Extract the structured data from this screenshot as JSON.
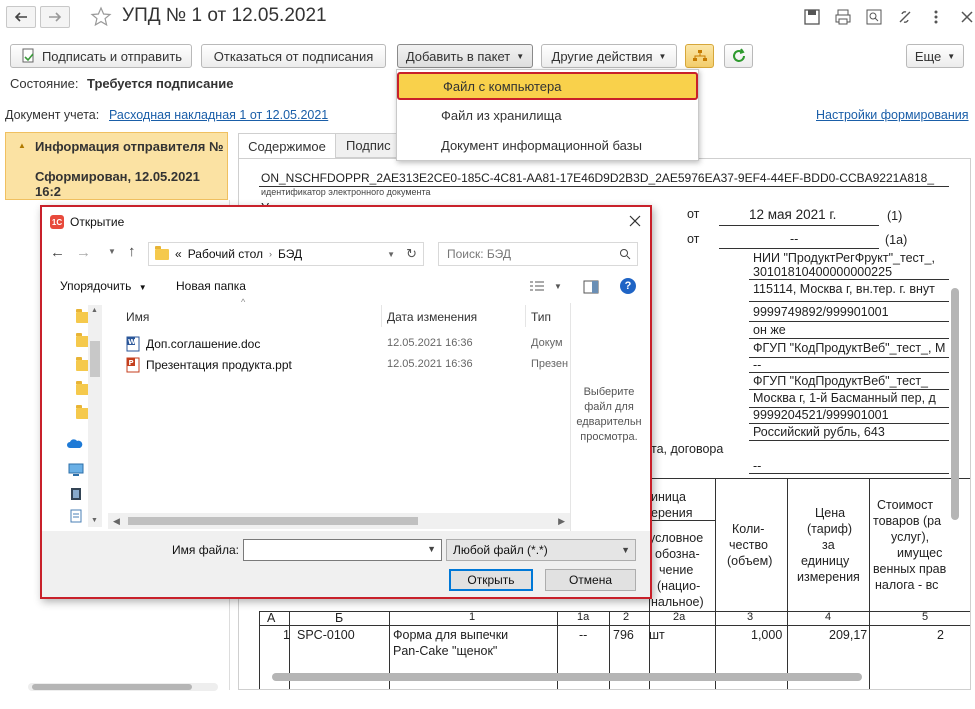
{
  "window": {
    "title": "УПД № 1 от 12.05.2021"
  },
  "toolbar": {
    "sign_send": "Подписать и отправить",
    "refuse_sign": "Отказаться от подписания",
    "add_to_package": "Добавить в пакет",
    "other_actions": "Другие действия",
    "more": "Еще"
  },
  "status": {
    "label": "Состояние:",
    "value": "Требуется подписание"
  },
  "account_doc": {
    "label": "Документ учета:",
    "link": "Расходная накладная 1 от 12.05.2021",
    "settings_link": "Настройки формирования"
  },
  "dropdown": {
    "items": [
      "Файл с компьютера",
      "Файл из хранилища",
      "Документ информационной базы"
    ]
  },
  "left_panel": {
    "title": "Информация отправителя №",
    "subtitle": "Сформирован, 12.05.2021 16:2"
  },
  "tabs": [
    "Содержимое",
    "Подпис"
  ],
  "document": {
    "id_line": "ON_NSCHFDOPPR_2AE313E2CE0-185C-4C81-AA81-17E46D9D2B3D_2AE5976EA37-9EF4-44EF-BDD0-CCBA9221A818_",
    "id_caption": "идентификатор электронного документа",
    "from1": "от",
    "date1": "12 мая 2021 г.",
    "mark1": "(1)",
    "from2": "от",
    "date2": "--",
    "mark2": "(1а)",
    "fields": [
      "НИИ \"ПродуктРегФрукт\"_тест_,",
      "30101810400000000225",
      "115114, Москва г, вн.тер. г. внут",
      "9999749892/999901001",
      "он же",
      "ФГУП \"КодПродуктВеб\"_тест_, М",
      "--",
      "ФГУП \"КодПродуктВеб\"_тест_",
      "Москва г, 1-й Басманный пер, д",
      "9999204521/999901001",
      "Российский рубль, 643"
    ],
    "contract_text": "та, договора",
    "dash": "--",
    "headers": {
      "unit": [
        "иница",
        "ерения"
      ],
      "unit_sub": [
        "условное",
        "обозна-",
        "чение",
        "(нацио-",
        "нальное)"
      ],
      "qty": [
        "Коли-",
        "чество",
        "(объем)"
      ],
      "price": [
        "Цена",
        "(тариф)",
        "за",
        "единицу",
        "измерения"
      ],
      "cost": [
        "Стоимост",
        "товаров (ра",
        "услуг),",
        "имущес",
        "венных прав",
        "налога - вс"
      ]
    },
    "col_nums": [
      "А",
      "Б",
      "1",
      "1а",
      "2",
      "2а",
      "3",
      "4",
      "5"
    ],
    "row": {
      "n": "1",
      "code": "SPC-0100",
      "name1": "Форма для выпечки",
      "name2": "Pan-Cake \"щенок\"",
      "dash": "--",
      "unit_code": "796",
      "unit": "шт",
      "qty": "1,000",
      "price": "209,17",
      "cost": "2"
    }
  },
  "dialog": {
    "title": "Открытие",
    "path_prefix": "«",
    "path": [
      "Рабочий стол",
      "БЭД"
    ],
    "search_placeholder": "Поиск: БЭД",
    "organize": "Упорядочить",
    "new_folder": "Новая папка",
    "columns": {
      "name": "Имя",
      "date": "Дата изменения",
      "type": "Тип"
    },
    "files": [
      {
        "name": "Доп.соглашение.doc",
        "date": "12.05.2021 16:36",
        "type": "Докум"
      },
      {
        "name": "Презентация продукта.ppt",
        "date": "12.05.2021 16:36",
        "type": "Презен"
      }
    ],
    "preview_text": [
      "Выберите",
      "файл для",
      "едварительн",
      "просмотра."
    ],
    "filename_label": "Имя файла:",
    "filetype": "Любой файл (*.*)",
    "open": "Открыть",
    "cancel": "Отмена"
  },
  "colors": {
    "highlight": "#f9d14b",
    "red_border": "#c8202a",
    "panel": "#fbe2a3",
    "link": "#1a5ea8"
  }
}
